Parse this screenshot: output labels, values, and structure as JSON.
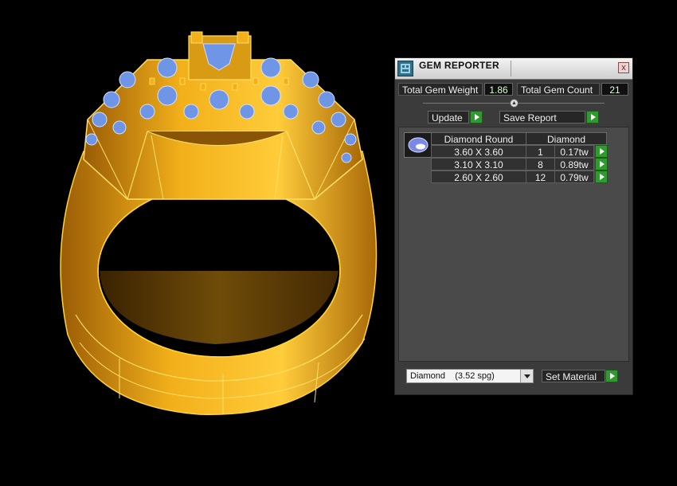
{
  "window": {
    "title": "GEM REPORTER",
    "close_symbol": "x"
  },
  "totals": {
    "weight_label": "Total Gem Weight",
    "weight_value": "1.86",
    "count_label": "Total Gem Count",
    "count_value": "21"
  },
  "buttons": {
    "update": "Update",
    "save_report": "Save Report",
    "set_material": "Set Material"
  },
  "table": {
    "headers": [
      "Diamond Round",
      "Diamond"
    ],
    "rows": [
      {
        "size": "3.60 X 3.60",
        "count": "1",
        "weight": "0.17tw"
      },
      {
        "size": "3.10 X 3.10",
        "count": "8",
        "weight": "0.89tw"
      },
      {
        "size": "2.60 X 2.60",
        "count": "12",
        "weight": "0.79tw"
      }
    ]
  },
  "material": {
    "selected": "Diamond    (3.52 spg)"
  },
  "colors": {
    "metal": "#f2b01a",
    "metal_shadow": "#b36f08",
    "gem": "#6f95e6",
    "accent_green": "#2f9b2f",
    "background": "#000000"
  }
}
